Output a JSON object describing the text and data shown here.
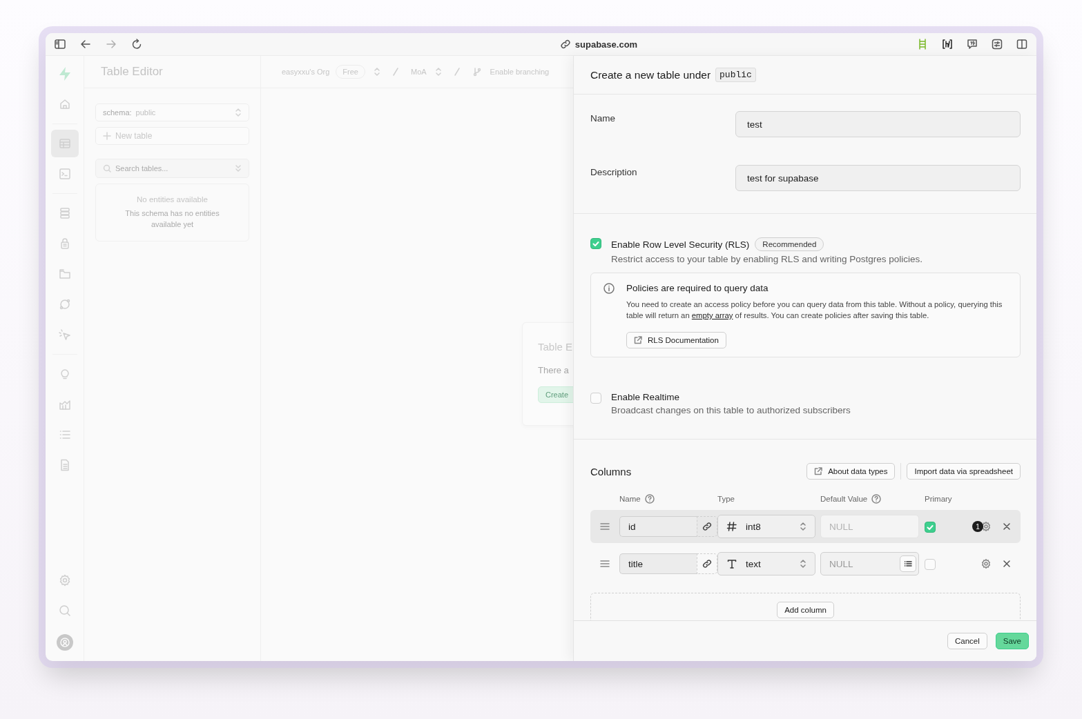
{
  "browser": {
    "url": "supabase.com"
  },
  "nav_groups": [
    [
      {
        "selected": false
      }
    ],
    [
      {
        "selected": true
      },
      {
        "selected": false
      }
    ],
    [
      {
        "selected": false
      },
      {
        "selected": false
      },
      {
        "selected": false
      },
      {
        "selected": false
      },
      {
        "selected": false
      }
    ],
    [
      {
        "selected": false
      },
      {
        "selected": false
      },
      {
        "selected": false
      },
      {
        "selected": false
      }
    ]
  ],
  "table_panel": {
    "title": "Table Editor",
    "schema_label": "schema:",
    "schema_value": "public",
    "new_table": "New table",
    "search_placeholder": "Search tables...",
    "empty_title": "No entities available",
    "empty_text": "This schema has no entities available yet"
  },
  "breadcrumb": {
    "org": "easyxxu's Org",
    "plan": "Free",
    "project": "MoA",
    "branching": "Enable branching"
  },
  "empty_card": {
    "title": "Table E",
    "text": "There a",
    "button": "Create"
  },
  "side_panel": {
    "title": "Create a new table under",
    "schema": "public",
    "fields": [
      {
        "label": "Name",
        "value": "test"
      },
      {
        "label": "Description",
        "value": "test for supabase"
      }
    ],
    "rls": {
      "checked": true,
      "label": "Enable Row Level Security (RLS)",
      "badge": "Recommended",
      "description": "Restrict access to your table by enabling RLS and writing Postgres policies.",
      "alert": {
        "title": "Policies are required to query data",
        "text_before": "You need to create an access policy before you can query data from this table. Without a policy, querying this table will return an ",
        "link": "empty array",
        "text_after": " of results. You can create policies after saving this table.",
        "button": "RLS Documentation"
      }
    },
    "realtime": {
      "checked": false,
      "label": "Enable Realtime",
      "description": "Broadcast changes on this table to authorized subscribers"
    },
    "columns": {
      "title": "Columns",
      "about_button": "About data types",
      "import_button": "Import data via spreadsheet",
      "headers": [
        "Name",
        "Type",
        "Default Value",
        "Primary"
      ],
      "rows": [
        {
          "name": "id",
          "kind": "numeric",
          "type": "int8",
          "default_placeholder": "NULL",
          "default_disabled": true,
          "primary": true,
          "highlighted": true,
          "badge": "1"
        },
        {
          "name": "title",
          "kind": "text",
          "type": "text",
          "default_placeholder": "NULL",
          "default_disabled": false,
          "primary": false,
          "highlighted": false
        }
      ],
      "add_button": "Add column"
    },
    "footer": {
      "cancel": "Cancel",
      "save": "Save"
    }
  }
}
